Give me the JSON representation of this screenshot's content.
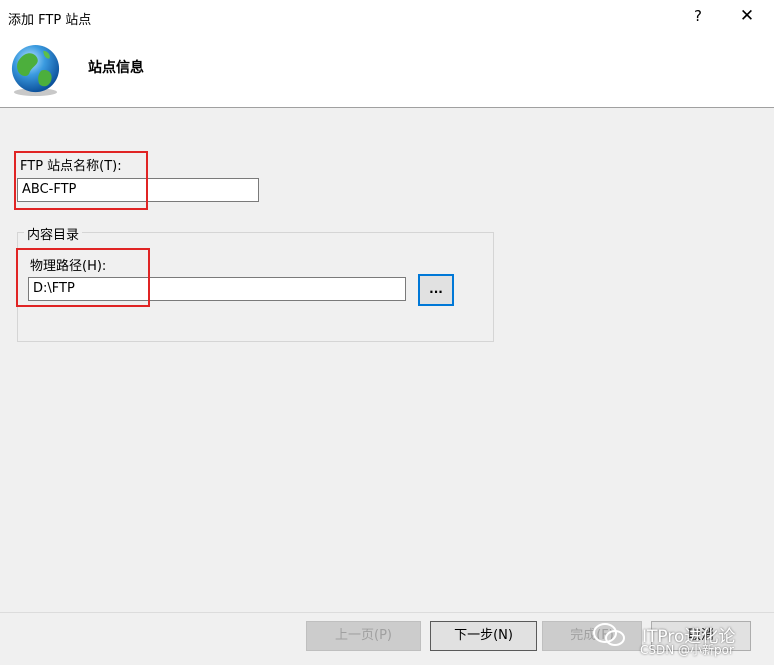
{
  "window": {
    "title": "添加 FTP 站点",
    "help_label": "?",
    "close_label": "✕"
  },
  "header": {
    "title": "站点信息"
  },
  "form": {
    "site_name_label": "FTP 站点名称(T):",
    "site_name_value": "ABC-FTP",
    "content_dir_legend": "内容目录",
    "physical_path_label": "物理路径(H):",
    "physical_path_value": "D:\\FTP",
    "browse_label": "..."
  },
  "footer": {
    "prev_label": "上一页(P)",
    "next_label": "下一步(N)",
    "finish_label": "完成(F)",
    "cancel_label": "取消"
  },
  "watermark": {
    "line1": "ITPro进化论",
    "line2": "CSDN @小新por"
  },
  "colors": {
    "highlight": "#e02424",
    "accent": "#0078d7"
  }
}
